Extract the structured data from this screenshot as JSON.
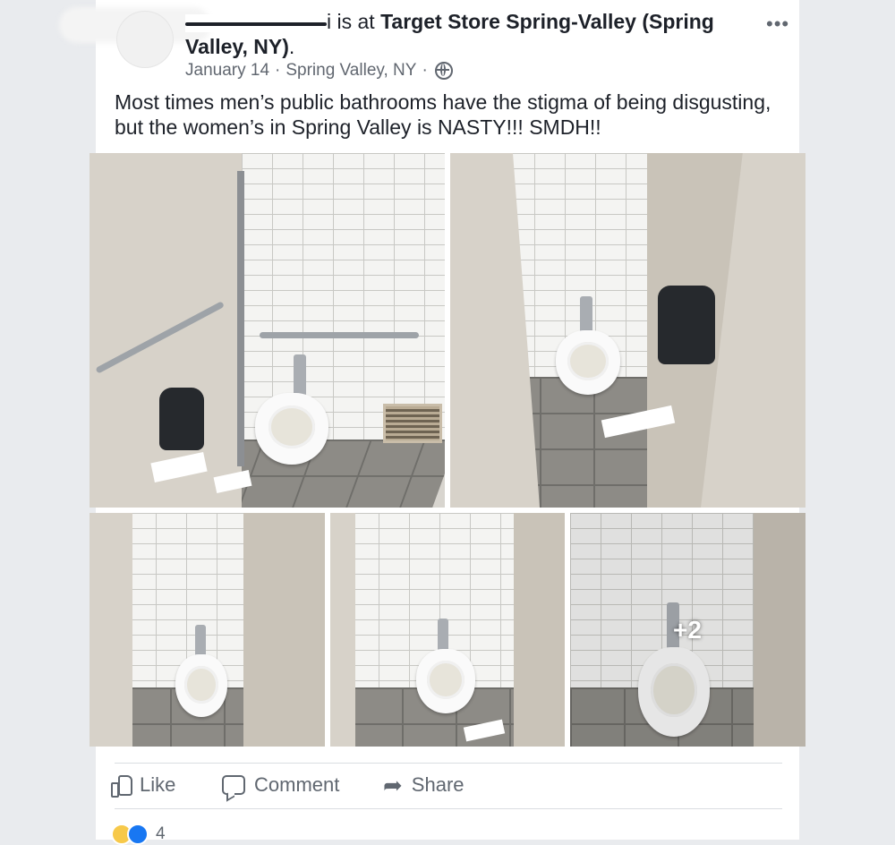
{
  "post": {
    "author_suffix": "i",
    "checkin_prefix": " is at ",
    "location_bold": "Target Store Spring-Valley (Spring Valley, NY)",
    "location_end": ".",
    "date": "January 14",
    "place": "Spring Valley, NY",
    "separator": "·",
    "privacy_icon": "globe-icon",
    "more_label": "•••",
    "text": "Most times men’s public bathrooms have the stigma of being disgusting, but the women’s in Spring Valley is NASTY!!! SMDH!!",
    "more_photos_label": "+2"
  },
  "actions": {
    "like": "Like",
    "comment": "Comment",
    "share": "Share"
  },
  "reactions": {
    "count": "4",
    "types": [
      "wow",
      "like"
    ]
  },
  "colors": {
    "page_bg": "#e9ebee",
    "card_bg": "#ffffff",
    "text": "#1d2129",
    "muted": "#606770",
    "like_blue": "#1877f2",
    "wow_yellow": "#f7c94a"
  }
}
